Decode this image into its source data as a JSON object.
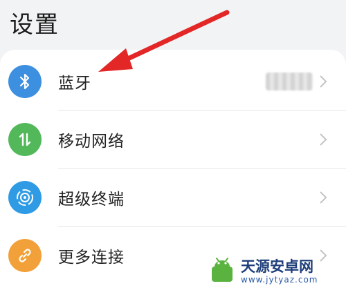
{
  "header": {
    "title": "设置"
  },
  "settings": {
    "items": [
      {
        "label": "蓝牙",
        "icon": "bluetooth-icon",
        "icon_color": "#3d8fe0"
      },
      {
        "label": "移动网络",
        "icon": "mobile-data-icon",
        "icon_color": "#52b85a"
      },
      {
        "label": "超级终端",
        "icon": "super-device-icon",
        "icon_color": "#2f9be4"
      },
      {
        "label": "更多连接",
        "icon": "link-icon",
        "icon_color": "#f2a13a"
      }
    ]
  },
  "annotation": {
    "arrow_color": "#e32626"
  },
  "watermark": {
    "name": "天源安卓网",
    "url": "www.jytyaz.com"
  }
}
